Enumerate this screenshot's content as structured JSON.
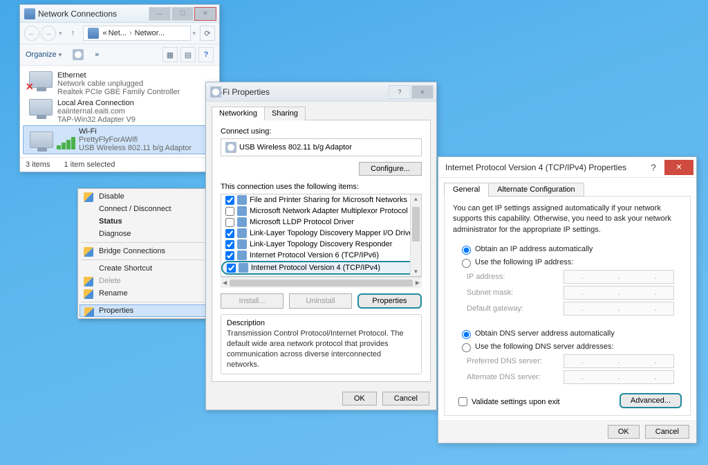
{
  "nc": {
    "title": "Network Connections",
    "path_seg1": "Net...",
    "path_seg2": "Networ...",
    "organize": "Organize",
    "items": [
      {
        "name": "Ethernet",
        "line2": "Network cable unplugged",
        "line3": "Realtek PCIe GBE Family Controller",
        "red": true
      },
      {
        "name": "Local Area Connection",
        "line2": "eaiinternal.eaiti.com",
        "line3": "TAP-Win32 Adapter V9",
        "red": false
      },
      {
        "name": "Wi-Fi",
        "line2": "PrettyFlyForAWifi",
        "line3": "USB Wireless 802.11 b/g Adaptor",
        "red": false
      }
    ],
    "status_items": "3 items",
    "status_sel": "1 item selected"
  },
  "ctx": {
    "disable": "Disable",
    "connect": "Connect / Disconnect",
    "status": "Status",
    "diagnose": "Diagnose",
    "bridge": "Bridge Connections",
    "shortcut": "Create Shortcut",
    "delete": "Delete",
    "rename": "Rename",
    "properties": "Properties"
  },
  "wf": {
    "title": "Wi-Fi Properties",
    "tab_networking": "Networking",
    "tab_sharing": "Sharing",
    "connect_using": "Connect using:",
    "adapter": "USB Wireless 802.11 b/g Adaptor",
    "configure": "Configure...",
    "uses_items": "This connection uses the following items:",
    "items": [
      {
        "label": "File and Printer Sharing for Microsoft Networks",
        "checked": true
      },
      {
        "label": "Microsoft Network Adapter Multiplexor Protocol",
        "checked": false
      },
      {
        "label": "Microsoft LLDP Protocol Driver",
        "checked": false
      },
      {
        "label": "Link-Layer Topology Discovery Mapper I/O Driver",
        "checked": true
      },
      {
        "label": "Link-Layer Topology Discovery Responder",
        "checked": true
      },
      {
        "label": "Internet Protocol Version 6 (TCP/IPv6)",
        "checked": true
      },
      {
        "label": "Internet Protocol Version 4 (TCP/IPv4)",
        "checked": true
      }
    ],
    "install": "Install...",
    "uninstall": "Uninstall",
    "properties": "Properties",
    "desc_hdr": "Description",
    "desc_body": "Transmission Control Protocol/Internet Protocol. The default wide area network protocol that provides communication across diverse interconnected networks.",
    "ok": "OK",
    "cancel": "Cancel"
  },
  "v4": {
    "title": "Internet Protocol Version 4 (TCP/IPv4) Properties",
    "tab_general": "General",
    "tab_alt": "Alternate Configuration",
    "desc": "You can get IP settings assigned automatically if your network supports this capability. Otherwise, you need to ask your network administrator for the appropriate IP settings.",
    "r_ip_auto": "Obtain an IP address automatically",
    "r_ip_man": "Use the following IP address:",
    "lab_ip": "IP address:",
    "lab_mask": "Subnet mask:",
    "lab_gw": "Default gateway:",
    "r_dns_auto": "Obtain DNS server address automatically",
    "r_dns_man": "Use the following DNS server addresses:",
    "lab_pdns": "Preferred DNS server:",
    "lab_adns": "Alternate DNS server:",
    "validate": "Validate settings upon exit",
    "advanced": "Advanced...",
    "ok": "OK",
    "cancel": "Cancel"
  }
}
